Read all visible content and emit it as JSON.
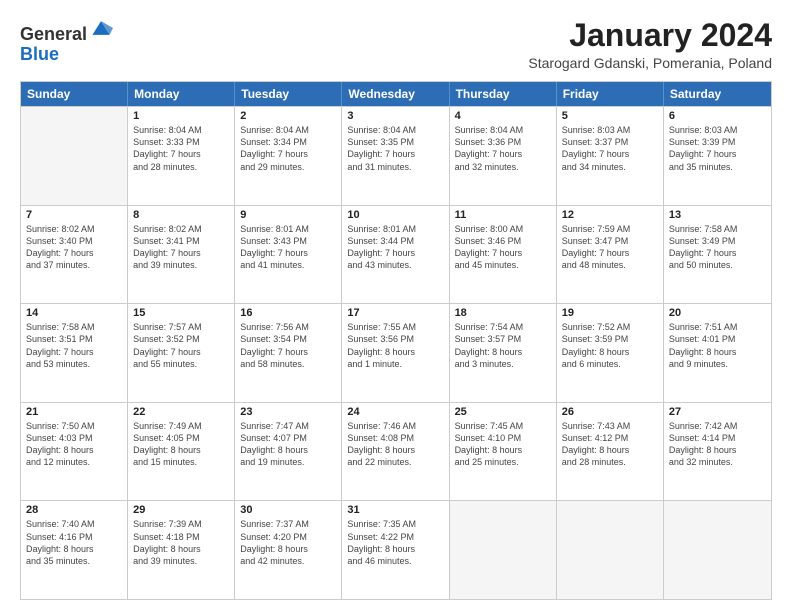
{
  "header": {
    "logo_general": "General",
    "logo_blue": "Blue",
    "month_title": "January 2024",
    "subtitle": "Starogard Gdanski, Pomerania, Poland"
  },
  "weekdays": [
    "Sunday",
    "Monday",
    "Tuesday",
    "Wednesday",
    "Thursday",
    "Friday",
    "Saturday"
  ],
  "rows": [
    [
      {
        "day": "",
        "info": ""
      },
      {
        "day": "1",
        "info": "Sunrise: 8:04 AM\nSunset: 3:33 PM\nDaylight: 7 hours\nand 28 minutes."
      },
      {
        "day": "2",
        "info": "Sunrise: 8:04 AM\nSunset: 3:34 PM\nDaylight: 7 hours\nand 29 minutes."
      },
      {
        "day": "3",
        "info": "Sunrise: 8:04 AM\nSunset: 3:35 PM\nDaylight: 7 hours\nand 31 minutes."
      },
      {
        "day": "4",
        "info": "Sunrise: 8:04 AM\nSunset: 3:36 PM\nDaylight: 7 hours\nand 32 minutes."
      },
      {
        "day": "5",
        "info": "Sunrise: 8:03 AM\nSunset: 3:37 PM\nDaylight: 7 hours\nand 34 minutes."
      },
      {
        "day": "6",
        "info": "Sunrise: 8:03 AM\nSunset: 3:39 PM\nDaylight: 7 hours\nand 35 minutes."
      }
    ],
    [
      {
        "day": "7",
        "info": "Sunrise: 8:02 AM\nSunset: 3:40 PM\nDaylight: 7 hours\nand 37 minutes."
      },
      {
        "day": "8",
        "info": "Sunrise: 8:02 AM\nSunset: 3:41 PM\nDaylight: 7 hours\nand 39 minutes."
      },
      {
        "day": "9",
        "info": "Sunrise: 8:01 AM\nSunset: 3:43 PM\nDaylight: 7 hours\nand 41 minutes."
      },
      {
        "day": "10",
        "info": "Sunrise: 8:01 AM\nSunset: 3:44 PM\nDaylight: 7 hours\nand 43 minutes."
      },
      {
        "day": "11",
        "info": "Sunrise: 8:00 AM\nSunset: 3:46 PM\nDaylight: 7 hours\nand 45 minutes."
      },
      {
        "day": "12",
        "info": "Sunrise: 7:59 AM\nSunset: 3:47 PM\nDaylight: 7 hours\nand 48 minutes."
      },
      {
        "day": "13",
        "info": "Sunrise: 7:58 AM\nSunset: 3:49 PM\nDaylight: 7 hours\nand 50 minutes."
      }
    ],
    [
      {
        "day": "14",
        "info": "Sunrise: 7:58 AM\nSunset: 3:51 PM\nDaylight: 7 hours\nand 53 minutes."
      },
      {
        "day": "15",
        "info": "Sunrise: 7:57 AM\nSunset: 3:52 PM\nDaylight: 7 hours\nand 55 minutes."
      },
      {
        "day": "16",
        "info": "Sunrise: 7:56 AM\nSunset: 3:54 PM\nDaylight: 7 hours\nand 58 minutes."
      },
      {
        "day": "17",
        "info": "Sunrise: 7:55 AM\nSunset: 3:56 PM\nDaylight: 8 hours\nand 1 minute."
      },
      {
        "day": "18",
        "info": "Sunrise: 7:54 AM\nSunset: 3:57 PM\nDaylight: 8 hours\nand 3 minutes."
      },
      {
        "day": "19",
        "info": "Sunrise: 7:52 AM\nSunset: 3:59 PM\nDaylight: 8 hours\nand 6 minutes."
      },
      {
        "day": "20",
        "info": "Sunrise: 7:51 AM\nSunset: 4:01 PM\nDaylight: 8 hours\nand 9 minutes."
      }
    ],
    [
      {
        "day": "21",
        "info": "Sunrise: 7:50 AM\nSunset: 4:03 PM\nDaylight: 8 hours\nand 12 minutes."
      },
      {
        "day": "22",
        "info": "Sunrise: 7:49 AM\nSunset: 4:05 PM\nDaylight: 8 hours\nand 15 minutes."
      },
      {
        "day": "23",
        "info": "Sunrise: 7:47 AM\nSunset: 4:07 PM\nDaylight: 8 hours\nand 19 minutes."
      },
      {
        "day": "24",
        "info": "Sunrise: 7:46 AM\nSunset: 4:08 PM\nDaylight: 8 hours\nand 22 minutes."
      },
      {
        "day": "25",
        "info": "Sunrise: 7:45 AM\nSunset: 4:10 PM\nDaylight: 8 hours\nand 25 minutes."
      },
      {
        "day": "26",
        "info": "Sunrise: 7:43 AM\nSunset: 4:12 PM\nDaylight: 8 hours\nand 28 minutes."
      },
      {
        "day": "27",
        "info": "Sunrise: 7:42 AM\nSunset: 4:14 PM\nDaylight: 8 hours\nand 32 minutes."
      }
    ],
    [
      {
        "day": "28",
        "info": "Sunrise: 7:40 AM\nSunset: 4:16 PM\nDaylight: 8 hours\nand 35 minutes."
      },
      {
        "day": "29",
        "info": "Sunrise: 7:39 AM\nSunset: 4:18 PM\nDaylight: 8 hours\nand 39 minutes."
      },
      {
        "day": "30",
        "info": "Sunrise: 7:37 AM\nSunset: 4:20 PM\nDaylight: 8 hours\nand 42 minutes."
      },
      {
        "day": "31",
        "info": "Sunrise: 7:35 AM\nSunset: 4:22 PM\nDaylight: 8 hours\nand 46 minutes."
      },
      {
        "day": "",
        "info": ""
      },
      {
        "day": "",
        "info": ""
      },
      {
        "day": "",
        "info": ""
      }
    ]
  ]
}
